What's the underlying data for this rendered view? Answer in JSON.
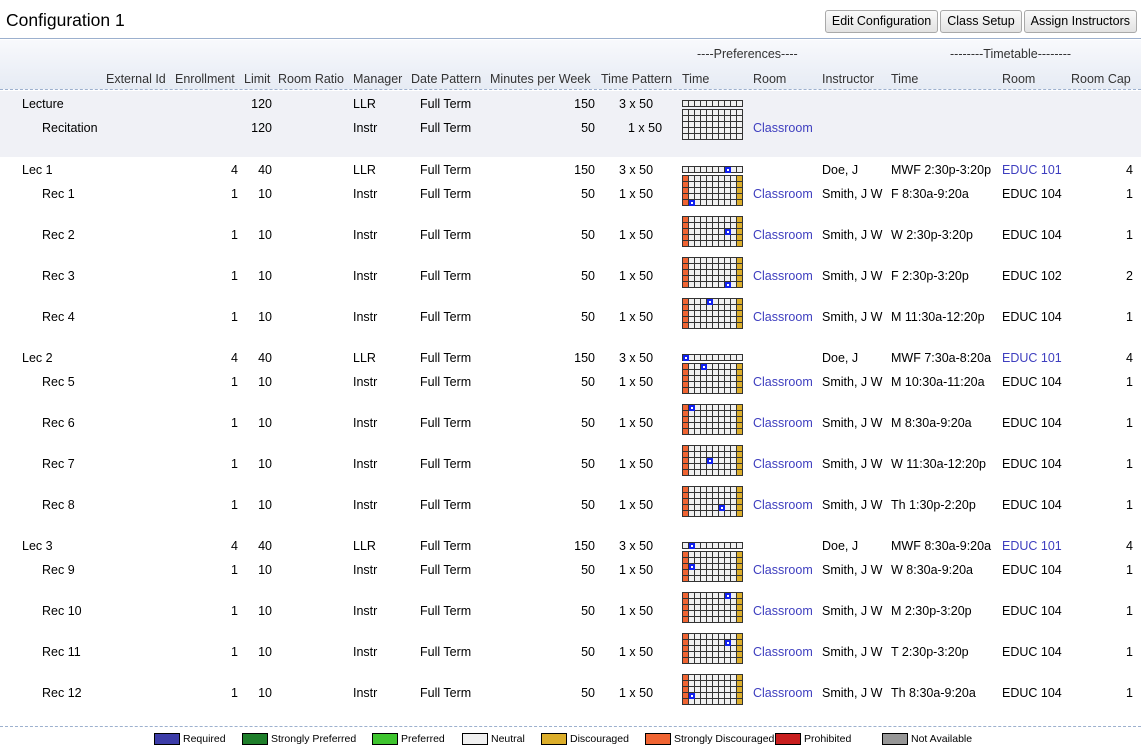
{
  "header": {
    "title": "Configuration 1",
    "buttons": {
      "edit_configuration": "Edit Configuration",
      "class_setup": "Class Setup",
      "assign_instructors": "Assign Instructors"
    }
  },
  "table": {
    "group_headers": {
      "preferences": "----Preferences----",
      "timetable": "--------Timetable--------"
    },
    "columns": {
      "external_id": "External Id",
      "enrollment": "Enrollment",
      "limit": "Limit",
      "room_ratio": "Room Ratio",
      "manager": "Manager",
      "date_pattern": "Date Pattern",
      "minutes_per_week": "Minutes per Week",
      "time_pattern": "Time Pattern",
      "pref_time": "Time",
      "pref_room": "Room",
      "instructor": "Instructor",
      "tt_time": "Time",
      "tt_room": "Room",
      "room_cap": "Room Cap"
    },
    "subparts": [
      {
        "name": "Lecture",
        "limit": "120",
        "manager": "LLR",
        "date_pattern": "Full Term",
        "minutes": "150",
        "time_pattern": "3 x 50",
        "grid": "lec",
        "pref_room": ""
      },
      {
        "name": "Recitation",
        "limit": "120",
        "manager": "Instr",
        "date_pattern": "Full Term",
        "minutes": "50",
        "time_pattern": "1 x 50",
        "grid": "rec",
        "pref_room": "Classroom"
      }
    ],
    "classes": [
      {
        "name": "Lec 1",
        "type": "lec",
        "enrollment": "4",
        "limit": "40",
        "manager": "LLR",
        "date_pattern": "Full Term",
        "minutes": "150",
        "time_pattern": "3 x 50",
        "selected": [
          0,
          7
        ],
        "pref_room": "",
        "instructor": "Doe, J",
        "time": "MWF 2:30p-3:20p",
        "room": "EDUC 101",
        "room_cap": "4"
      },
      {
        "name": "Rec 1",
        "type": "rec",
        "enrollment": "1",
        "limit": "10",
        "manager": "Instr",
        "date_pattern": "Full Term",
        "minutes": "50",
        "time_pattern": "1 x 50",
        "selected": [
          4,
          1
        ],
        "pref_room": "Classroom",
        "instructor": "Smith, J W",
        "time": "F 8:30a-9:20a",
        "room": "EDUC 104",
        "room_cap": "1"
      },
      {
        "name": "Rec 2",
        "type": "rec",
        "enrollment": "1",
        "limit": "10",
        "manager": "Instr",
        "date_pattern": "Full Term",
        "minutes": "50",
        "time_pattern": "1 x 50",
        "selected": [
          2,
          7
        ],
        "pref_room": "Classroom",
        "instructor": "Smith, J W",
        "time": "W 2:30p-3:20p",
        "room": "EDUC 104",
        "room_cap": "1"
      },
      {
        "name": "Rec 3",
        "type": "rec",
        "enrollment": "1",
        "limit": "10",
        "manager": "Instr",
        "date_pattern": "Full Term",
        "minutes": "50",
        "time_pattern": "1 x 50",
        "selected": [
          4,
          7
        ],
        "pref_room": "Classroom",
        "instructor": "Smith, J W",
        "time": "F 2:30p-3:20p",
        "room": "EDUC 102",
        "room_cap": "2"
      },
      {
        "name": "Rec 4",
        "type": "rec",
        "enrollment": "1",
        "limit": "10",
        "manager": "Instr",
        "date_pattern": "Full Term",
        "minutes": "50",
        "time_pattern": "1 x 50",
        "selected": [
          0,
          4
        ],
        "pref_room": "Classroom",
        "instructor": "Smith, J W",
        "time": "M 11:30a-12:20p",
        "room": "EDUC 104",
        "room_cap": "1"
      },
      {
        "name": "Lec 2",
        "type": "lec",
        "enrollment": "4",
        "limit": "40",
        "manager": "LLR",
        "date_pattern": "Full Term",
        "minutes": "150",
        "time_pattern": "3 x 50",
        "selected": [
          0,
          0
        ],
        "pref_room": "",
        "instructor": "Doe, J",
        "time": "MWF 7:30a-8:20a",
        "room": "EDUC 101",
        "room_cap": "4"
      },
      {
        "name": "Rec 5",
        "type": "rec",
        "enrollment": "1",
        "limit": "10",
        "manager": "Instr",
        "date_pattern": "Full Term",
        "minutes": "50",
        "time_pattern": "1 x 50",
        "selected": [
          0,
          3
        ],
        "pref_room": "Classroom",
        "instructor": "Smith, J W",
        "time": "M 10:30a-11:20a",
        "room": "EDUC 104",
        "room_cap": "1"
      },
      {
        "name": "Rec 6",
        "type": "rec",
        "enrollment": "1",
        "limit": "10",
        "manager": "Instr",
        "date_pattern": "Full Term",
        "minutes": "50",
        "time_pattern": "1 x 50",
        "selected": [
          0,
          1
        ],
        "pref_room": "Classroom",
        "instructor": "Smith, J W",
        "time": "M 8:30a-9:20a",
        "room": "EDUC 104",
        "room_cap": "1"
      },
      {
        "name": "Rec 7",
        "type": "rec",
        "enrollment": "1",
        "limit": "10",
        "manager": "Instr",
        "date_pattern": "Full Term",
        "minutes": "50",
        "time_pattern": "1 x 50",
        "selected": [
          2,
          4
        ],
        "pref_room": "Classroom",
        "instructor": "Smith, J W",
        "time": "W 11:30a-12:20p",
        "room": "EDUC 104",
        "room_cap": "1"
      },
      {
        "name": "Rec 8",
        "type": "rec",
        "enrollment": "1",
        "limit": "10",
        "manager": "Instr",
        "date_pattern": "Full Term",
        "minutes": "50",
        "time_pattern": "1 x 50",
        "selected": [
          3,
          6
        ],
        "pref_room": "Classroom",
        "instructor": "Smith, J W",
        "time": "Th 1:30p-2:20p",
        "room": "EDUC 104",
        "room_cap": "1"
      },
      {
        "name": "Lec 3",
        "type": "lec",
        "enrollment": "4",
        "limit": "40",
        "manager": "LLR",
        "date_pattern": "Full Term",
        "minutes": "150",
        "time_pattern": "3 x 50",
        "selected": [
          0,
          1
        ],
        "pref_room": "",
        "instructor": "Doe, J",
        "time": "MWF 8:30a-9:20a",
        "room": "EDUC 101",
        "room_cap": "4"
      },
      {
        "name": "Rec 9",
        "type": "rec",
        "enrollment": "1",
        "limit": "10",
        "manager": "Instr",
        "date_pattern": "Full Term",
        "minutes": "50",
        "time_pattern": "1 x 50",
        "selected": [
          2,
          1
        ],
        "pref_room": "Classroom",
        "instructor": "Smith, J W",
        "time": "W 8:30a-9:20a",
        "room": "EDUC 104",
        "room_cap": "1"
      },
      {
        "name": "Rec 10",
        "type": "rec",
        "enrollment": "1",
        "limit": "10",
        "manager": "Instr",
        "date_pattern": "Full Term",
        "minutes": "50",
        "time_pattern": "1 x 50",
        "selected": [
          0,
          7
        ],
        "pref_room": "Classroom",
        "instructor": "Smith, J W",
        "time": "M 2:30p-3:20p",
        "room": "EDUC 104",
        "room_cap": "1"
      },
      {
        "name": "Rec 11",
        "type": "rec",
        "enrollment": "1",
        "limit": "10",
        "manager": "Instr",
        "date_pattern": "Full Term",
        "minutes": "50",
        "time_pattern": "1 x 50",
        "selected": [
          1,
          7
        ],
        "pref_room": "Classroom",
        "instructor": "Smith, J W",
        "time": "T 2:30p-3:20p",
        "room": "EDUC 104",
        "room_cap": "1"
      },
      {
        "name": "Rec 12",
        "type": "rec",
        "enrollment": "1",
        "limit": "10",
        "manager": "Instr",
        "date_pattern": "Full Term",
        "minutes": "50",
        "time_pattern": "1 x 50",
        "selected": [
          3,
          1
        ],
        "pref_room": "Classroom",
        "instructor": "Smith, J W",
        "time": "Th 8:30a-9:20a",
        "room": "EDUC 104",
        "room_cap": "1"
      }
    ]
  },
  "legend": [
    {
      "label": "Required",
      "color": "#3c3ca8"
    },
    {
      "label": "Strongly Preferred",
      "color": "#1e7e2a"
    },
    {
      "label": "Preferred",
      "color": "#3ec42e"
    },
    {
      "label": "Neutral",
      "color": "#f0f0f0"
    },
    {
      "label": "Discouraged",
      "color": "#dcae2a"
    },
    {
      "label": "Strongly Discouraged",
      "color": "#f06432"
    },
    {
      "label": "Prohibited",
      "color": "#c81e1e"
    },
    {
      "label": "Not Available",
      "color": "#969696"
    }
  ],
  "colors": {
    "link": "#3e3ebf",
    "selected_time": "#1020f0"
  }
}
